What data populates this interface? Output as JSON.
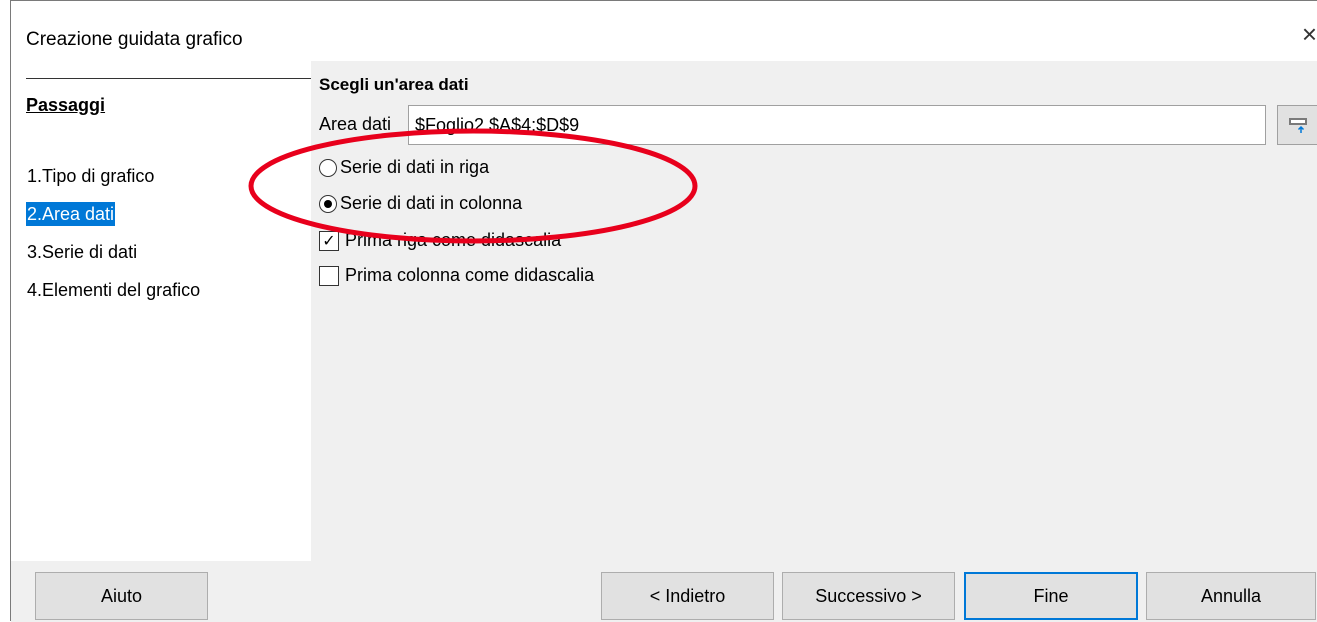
{
  "window": {
    "title": "Creazione guidata grafico",
    "close_symbol": "×"
  },
  "sidebar": {
    "heading": "Passaggi",
    "steps": [
      {
        "label": "1.Tipo di grafico"
      },
      {
        "label": "2.Area dati"
      },
      {
        "label": "3.Serie di dati"
      },
      {
        "label": "4.Elementi del grafico"
      }
    ],
    "active_step": 2
  },
  "main": {
    "heading": "Scegli un'area dati",
    "area_label": "Area dati",
    "area_value": "$Foglio2.$A$4:$D$9",
    "radios": [
      {
        "label": "Serie di dati in riga",
        "selected": false
      },
      {
        "label": "Serie di dati in colonna",
        "selected": true
      }
    ],
    "checkboxes": [
      {
        "label": "Prima riga come didascalia",
        "checked": true
      },
      {
        "label": "Prima colonna come didascalia",
        "checked": false
      }
    ]
  },
  "buttons": {
    "help": "Aiuto",
    "back": "< Indietro",
    "next": "Successivo >",
    "finish": "Fine",
    "cancel": "Annulla"
  },
  "colors": {
    "accent": "#0078d7",
    "annotation": "#e8001c",
    "panel": "#f0f0f0"
  }
}
